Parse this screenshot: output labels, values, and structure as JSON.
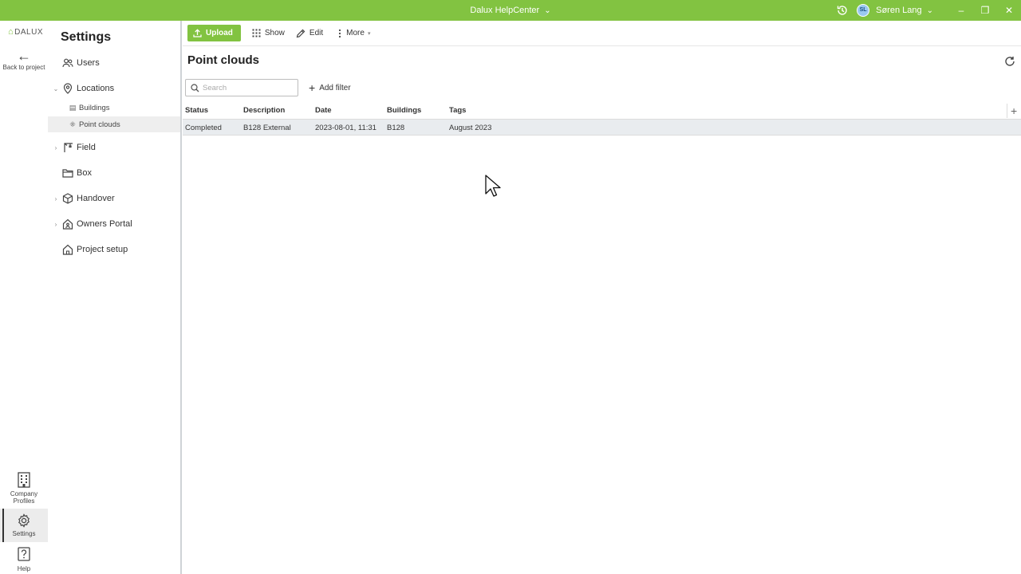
{
  "titlebar": {
    "app_title": "Dalux HelpCenter",
    "user_initials": "SL",
    "user_name": "Søren Lang",
    "chevron": "⌄",
    "minimize": "–",
    "restore": "❐",
    "close": "✕"
  },
  "rail": {
    "logo": "DALUX",
    "back_label": "Back to project",
    "company_label": "Company Profiles",
    "settings_label": "Settings",
    "help_label": "Help"
  },
  "sidebar": {
    "title": "Settings",
    "items": [
      {
        "label": "Users"
      },
      {
        "label": "Locations"
      },
      {
        "label": "Field"
      },
      {
        "label": "Box"
      },
      {
        "label": "Handover"
      },
      {
        "label": "Owners Portal"
      },
      {
        "label": "Project setup"
      }
    ],
    "sub_items": [
      {
        "label": "Buildings"
      },
      {
        "label": "Point clouds"
      }
    ]
  },
  "toolbar": {
    "upload_label": "Upload",
    "show_label": "Show",
    "edit_label": "Edit",
    "more_label": "More"
  },
  "main": {
    "page_title": "Point clouds",
    "search_placeholder": "Search",
    "add_filter_label": "Add filter",
    "add_column": "+",
    "columns": [
      "Status",
      "Description",
      "Date",
      "Buildings",
      "Tags"
    ],
    "rows": [
      {
        "status": "Completed",
        "description": "B128 External",
        "date": "2023-08-01, 11:31",
        "buildings": "B128",
        "tags": "August 2023"
      }
    ]
  },
  "colors": {
    "brand": "#82c341",
    "row_selected": "#e9ecef"
  }
}
